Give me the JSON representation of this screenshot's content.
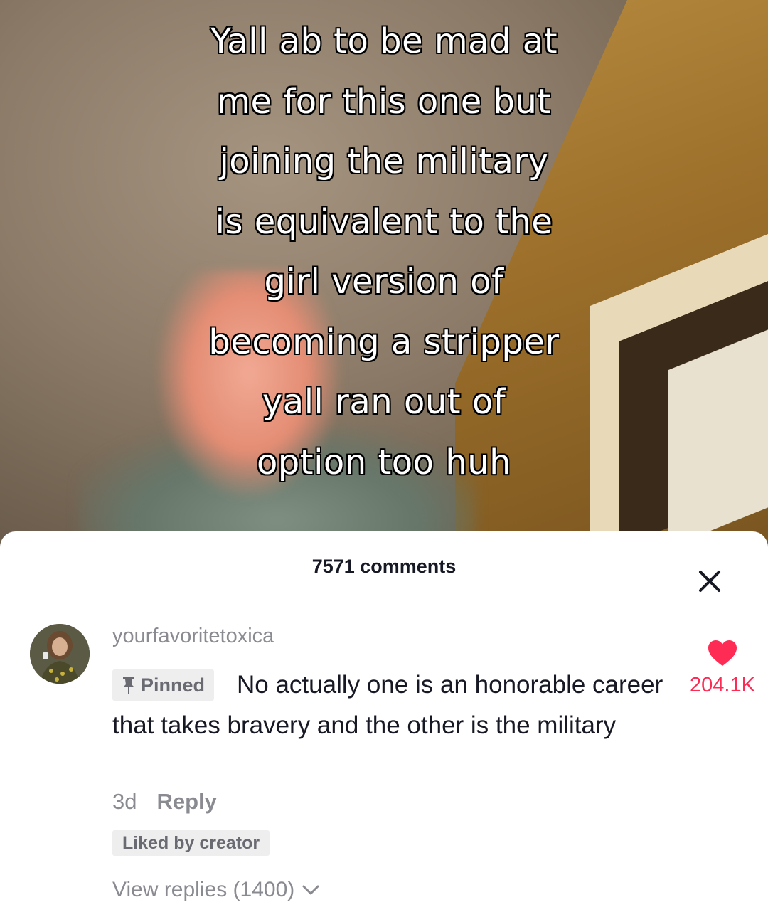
{
  "video": {
    "caption_lines": [
      "Yall ab to be mad at",
      "me for this one but",
      "joining the military",
      "is equivalent to the",
      "girl version of",
      "becoming a stripper",
      "yall ran out of",
      "option too huh"
    ]
  },
  "comments_sheet": {
    "title": "7571 comments",
    "close_icon": "close-icon",
    "comments": [
      {
        "username": "yourfavoritetoxica",
        "pinned_label": "Pinned",
        "pin_icon": "pin-icon",
        "text": "No actually one is an honorable career that takes bravery and the other is the military",
        "like_icon": "heart-icon",
        "like_count": "204.1K",
        "age": "3d",
        "reply_label": "Reply",
        "liked_by_creator_label": "Liked by creator",
        "view_replies_label": "View replies (1400)",
        "view_replies_icon": "chevron-down-icon"
      }
    ]
  },
  "colors": {
    "accent_like": "#fe2c55",
    "text_primary": "#161823",
    "text_secondary": "#8a8b91",
    "badge_bg": "#eeeeef"
  }
}
